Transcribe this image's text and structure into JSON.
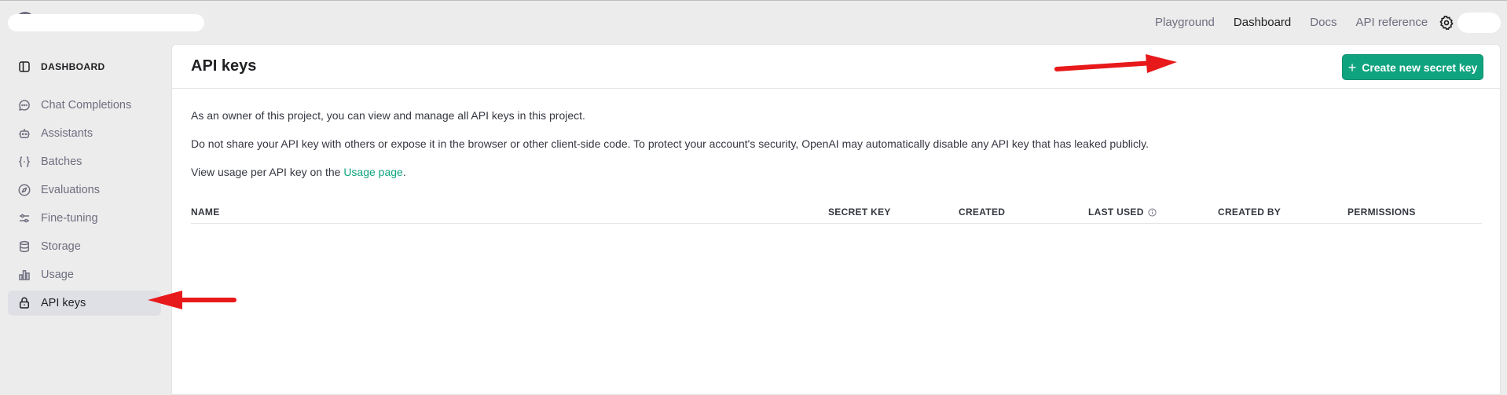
{
  "topnav": {
    "items": [
      {
        "label": "Playground",
        "active": false
      },
      {
        "label": "Dashboard",
        "active": true
      },
      {
        "label": "Docs",
        "active": false
      },
      {
        "label": "API reference",
        "active": false
      }
    ],
    "settings_icon": "gear-icon"
  },
  "sidebar": {
    "heading": "DASHBOARD",
    "heading_icon": "sidebar-toggle-icon",
    "items": [
      {
        "label": "Chat Completions",
        "icon": "chat-bubble-icon",
        "active": false
      },
      {
        "label": "Assistants",
        "icon": "robot-icon",
        "active": false
      },
      {
        "label": "Batches",
        "icon": "braces-icon",
        "active": false
      },
      {
        "label": "Evaluations",
        "icon": "compass-icon",
        "active": false
      },
      {
        "label": "Fine-tuning",
        "icon": "sliders-icon",
        "active": false
      },
      {
        "label": "Storage",
        "icon": "database-icon",
        "active": false
      },
      {
        "label": "Usage",
        "icon": "bar-chart-icon",
        "active": false
      },
      {
        "label": "API keys",
        "icon": "lock-icon",
        "active": true
      }
    ]
  },
  "main": {
    "title": "API keys",
    "create_button": "Create new secret key",
    "para1": "As an owner of this project, you can view and manage all API keys in this project.",
    "para2": "Do not share your API key with others or expose it in the browser or other client-side code. To protect your account's security, OpenAI may automatically disable any API key that has leaked publicly.",
    "para3_prefix": "View usage per API key on the ",
    "para3_link": "Usage page",
    "para3_suffix": ".",
    "table": {
      "columns": [
        "NAME",
        "SECRET KEY",
        "CREATED",
        "LAST USED",
        "CREATED BY",
        "PERMISSIONS"
      ]
    }
  },
  "colors": {
    "accent": "#10a37f",
    "annotation_arrow": "#e8191b"
  }
}
